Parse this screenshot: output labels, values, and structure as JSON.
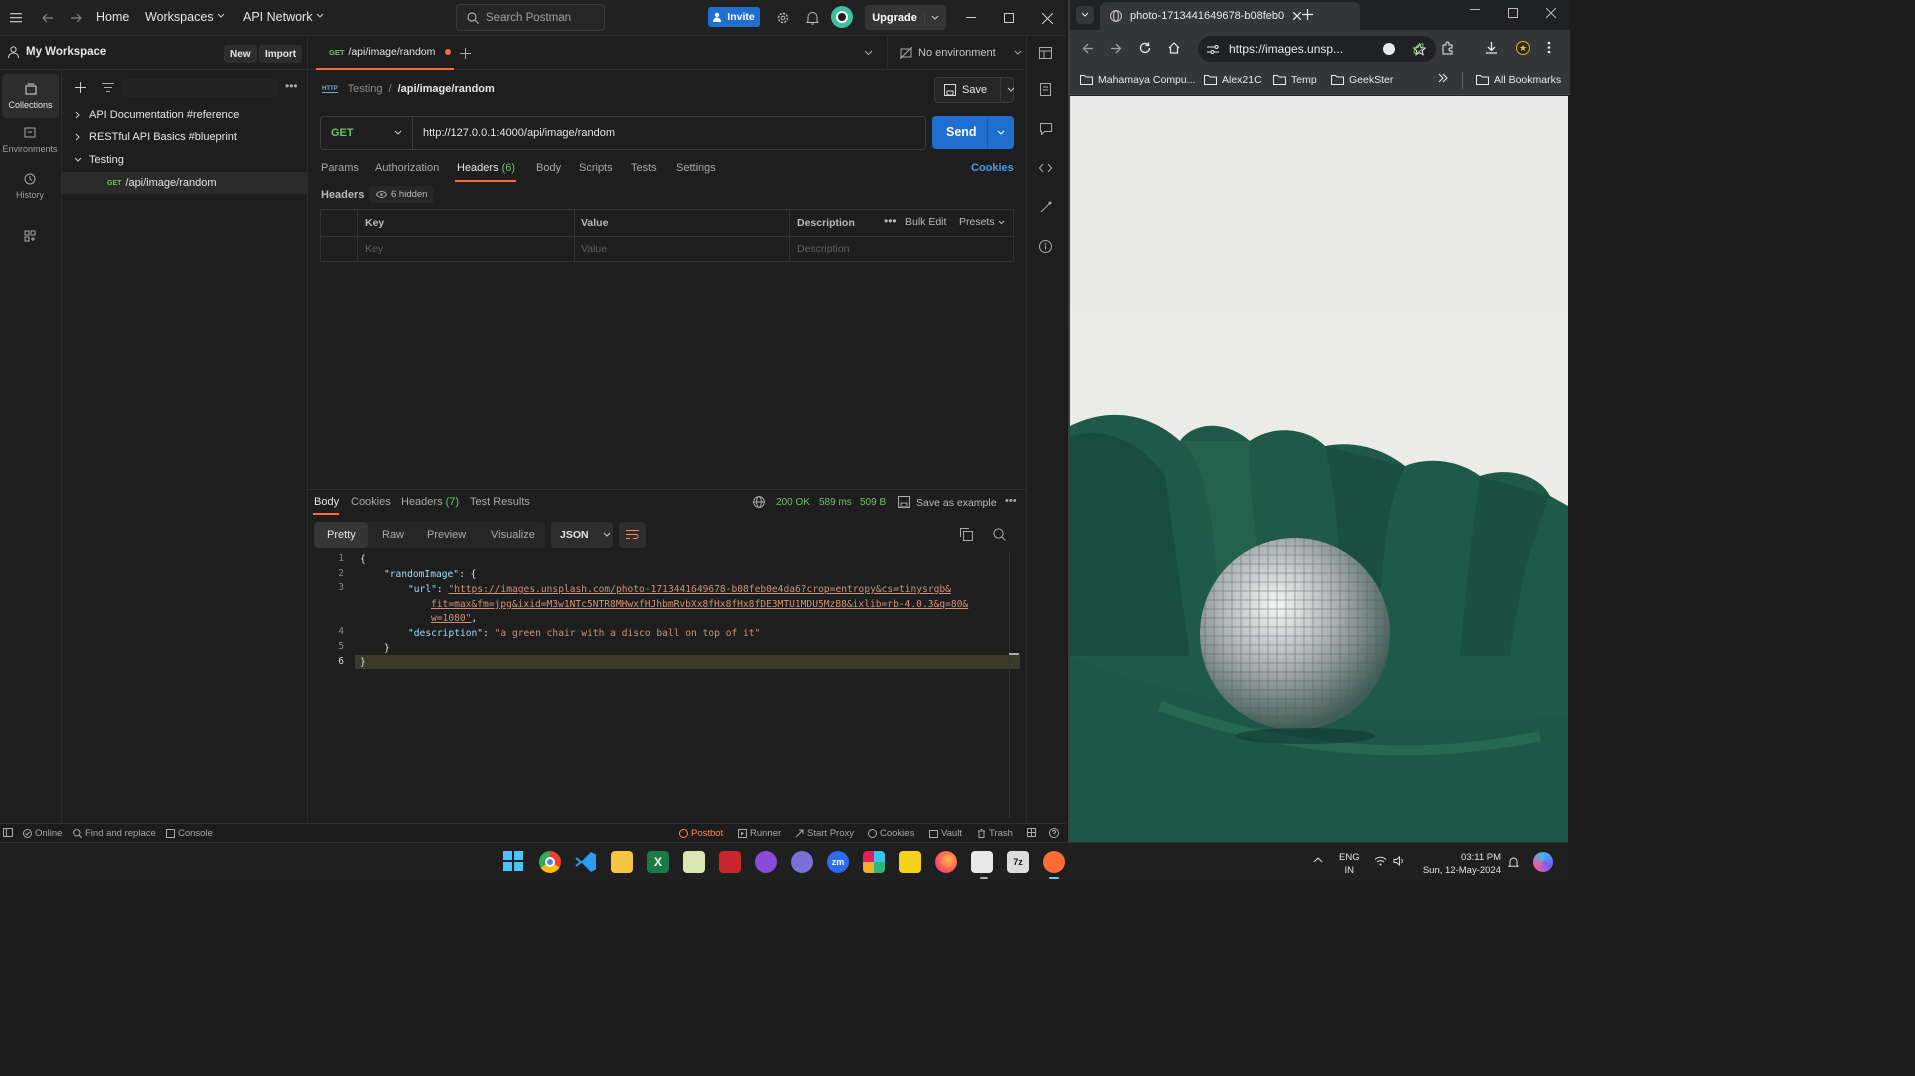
{
  "postman": {
    "nav": {
      "home": "Home",
      "workspaces": "Workspaces",
      "api_network": "API Network",
      "search_placeholder": "Search Postman",
      "invite": "Invite",
      "upgrade": "Upgrade"
    },
    "workspace": {
      "name": "My Workspace",
      "new": "New",
      "import": "Import"
    },
    "rail": [
      {
        "label": "Collections",
        "icon": "collections-icon"
      },
      {
        "label": "Environments",
        "icon": "environments-icon"
      },
      {
        "label": "History",
        "icon": "history-icon"
      },
      {
        "label": "",
        "icon": "apps-icon"
      }
    ],
    "collections": [
      {
        "label": "API Documentation #reference"
      },
      {
        "label": "RESTful API Basics #blueprint"
      },
      {
        "label": "Testing"
      }
    ],
    "request_item": {
      "method": "GET",
      "label": "/api/image/random"
    },
    "tab": {
      "method": "GET",
      "label": "/api/image/random"
    },
    "environment": "No environment",
    "breadcrumb": {
      "parent": "Testing",
      "sep": "/",
      "current": "/api/image/random"
    },
    "save": "Save",
    "request": {
      "method": "GET",
      "url": "http://127.0.0.1:4000/api/image/random",
      "send": "Send"
    },
    "req_tabs": [
      "Params",
      "Authorization",
      "Headers",
      "Body",
      "Scripts",
      "Tests",
      "Settings"
    ],
    "headers_count": "(6)",
    "cookies_link": "Cookies",
    "headers_label": "Headers",
    "hidden_label": "6 hidden",
    "grid": {
      "key": "Key",
      "value": "Value",
      "description": "Description",
      "bulk_edit": "Bulk Edit",
      "presets": "Presets",
      "key_ph": "Key",
      "value_ph": "Value",
      "desc_ph": "Description"
    },
    "resp_tabs": {
      "body": "Body",
      "cookies": "Cookies",
      "headers": "Headers",
      "headers_count": "(7)",
      "test_results": "Test Results"
    },
    "resp_meta": {
      "status": "200 OK",
      "time": "589 ms",
      "size": "509 B",
      "save_example": "Save as example"
    },
    "view_tabs": [
      "Pretty",
      "Raw",
      "Preview",
      "Visualize"
    ],
    "format": "JSON",
    "code": {
      "line_numbers": [
        "1",
        "2",
        "3",
        "",
        "",
        "4",
        "5",
        "6"
      ],
      "l1": "{",
      "l2_key": "\"randomImage\"",
      "l2_rest": ": {",
      "l3_key": "\"url\"",
      "l3_colon": ": ",
      "l3_url1": "\"https://images.unsplash.com/photo-1713441649678-b08feb0e4da6?crop=entropy&cs=tinysrgb&",
      "l3_url2": "fit=max&fm=jpg&ixid=M3w1NTc5NTR8MHwxfHJhbmRvbXx8fHx8fHx8fDE3MTU1MDU5MzB8&ixlib=rb-4.0.3&q=80&",
      "l3_url3": "w=1080\"",
      "l3_comma": ",",
      "l4_key": "\"description\"",
      "l4_colon": ": ",
      "l4_val": "\"a green chair with a disco ball on top of it\"",
      "l5": "}",
      "l6": "}"
    },
    "statusbar": {
      "online": "Online",
      "find": "Find and replace",
      "console": "Console",
      "postbot": "Postbot",
      "runner": "Runner",
      "proxy": "Start Proxy",
      "cookies": "Cookies",
      "vault": "Vault",
      "trash": "Trash"
    }
  },
  "browser": {
    "tab_title": "photo-1713441649678-b08feb0",
    "url": "https://images.unsp...",
    "bookmarks": [
      "Mahamaya Compu...",
      "Alex21C",
      "Temp",
      "GeekSter"
    ],
    "all_bookmarks": "All Bookmarks",
    "photo_description_colors": {
      "wall": "#eeeeec",
      "chair": "#1f5a48",
      "ball": "#b8bcbc"
    }
  },
  "taskbar": {
    "lang1": "ENG",
    "lang2": "IN",
    "time": "03:11 PM",
    "date": "Sun, 12-May-2024"
  },
  "colors": {
    "accent_orange": "#ff6c37",
    "accent_blue": "#1f6fd1",
    "ok_green": "#6fc267",
    "json_key": "#9cdcfe",
    "json_string": "#ce9178"
  }
}
